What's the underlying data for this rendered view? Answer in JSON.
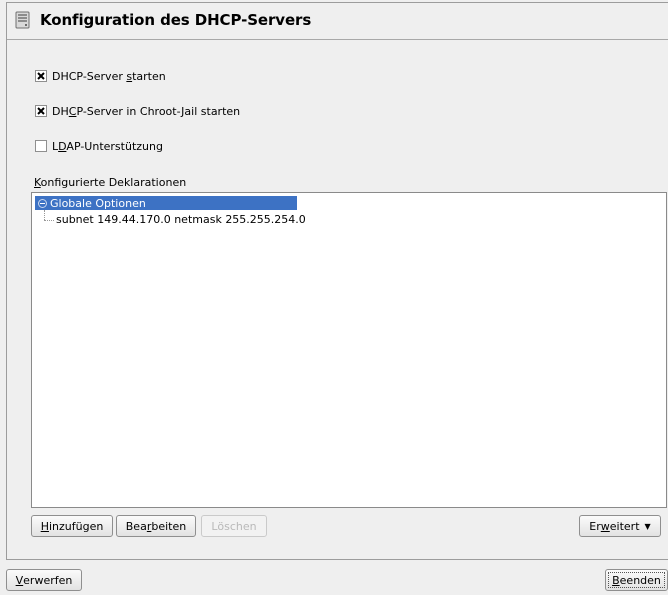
{
  "header": {
    "title": "Konfiguration des DHCP-Servers"
  },
  "options": {
    "start_server": {
      "pre": "DHCP-Server ",
      "accel": "s",
      "post": "tarten",
      "checked": true
    },
    "chroot": {
      "pre": "DH",
      "accel": "C",
      "post": "P-Server in Chroot-Jail starten",
      "checked": true
    },
    "ldap": {
      "pre": "L",
      "accel": "D",
      "post": "AP-Unterstützung",
      "checked": false
    }
  },
  "declarations": {
    "label": {
      "pre": "",
      "accel": "K",
      "post": "onfigurierte Deklarationen"
    },
    "root": "Globale Optionen",
    "child": "subnet 149.44.170.0 netmask 255.255.254.0"
  },
  "buttons": {
    "add": {
      "pre": "",
      "accel": "H",
      "post": "inzufügen"
    },
    "edit": {
      "pre": "Bea",
      "accel": "r",
      "post": "beiten"
    },
    "delete": {
      "label": "Löschen"
    },
    "advanced": {
      "pre": "Er",
      "accel": "w",
      "post": "eitert",
      "arrow": "▼"
    },
    "discard": {
      "pre": "",
      "accel": "V",
      "post": "erwerfen"
    },
    "finish": {
      "pre": "",
      "accel": "B",
      "post": "eenden"
    }
  }
}
